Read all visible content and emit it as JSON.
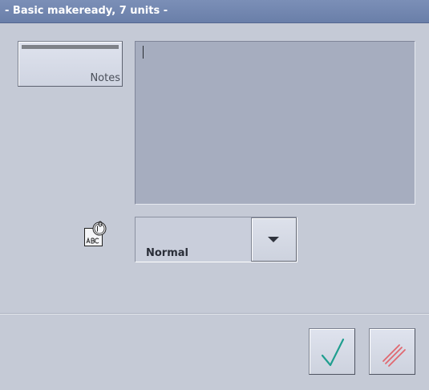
{
  "window": {
    "title": "- Basic makeready, 7 units -"
  },
  "notes": {
    "button_label": "Notes",
    "text_value": ""
  },
  "priority": {
    "icon": "abc-10-icon",
    "selected_value": "Normal",
    "dropdown_icon": "triangle-down-icon"
  },
  "actions": {
    "ok_icon": "checkmark-icon",
    "cancel_icon": "hatch-cancel-icon"
  },
  "colors": {
    "titlebar": "#6f84ad",
    "background": "#c5cad6",
    "text_area": "#a6adbf",
    "ok_accent": "#1f9e8f",
    "cancel_accent": "#e06870"
  }
}
